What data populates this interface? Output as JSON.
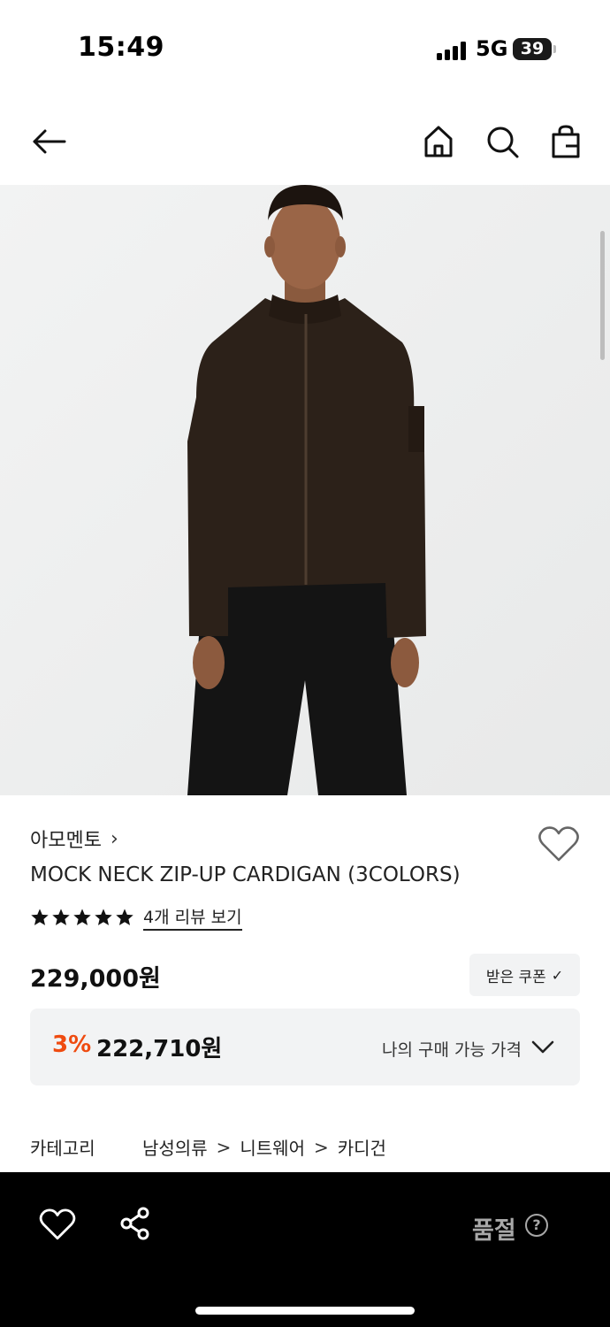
{
  "status_bar": {
    "time": "15:49",
    "network": "5G",
    "battery": "39"
  },
  "nav": {
    "back_icon": "arrow-left-icon",
    "home_icon": "home-icon",
    "search_icon": "search-icon",
    "cart_icon": "shopping-bag-icon"
  },
  "product": {
    "image_alt": "model wearing dark brown zip-up cardigan",
    "brand": "아모멘토",
    "brand_chevron": "›",
    "name": "MOCK NECK ZIP-UP CARDIGAN (3COLORS)",
    "rating": 5,
    "rating_max": 5,
    "review_link": "4개 리뷰 보기",
    "price": "229,000원",
    "coupon_label": "받은 쿠폰",
    "coupon_check": "✓",
    "discount_rate": "3%",
    "final_price": "222,710원",
    "my_price_label": "나의 구매 가능 가격"
  },
  "category": {
    "label": "카테고리",
    "path": [
      "남성의류",
      "니트웨어",
      "카디건"
    ],
    "separator": ">"
  },
  "bottom_bar": {
    "wishlist_icon": "heart-icon",
    "share_icon": "share-icon",
    "status": "품절",
    "help": "?"
  },
  "colors": {
    "discount": "#ef4b10",
    "bottom_bar_bg": "#000000",
    "soldout_text": "#a8a8a8",
    "panel_bg": "#f2f3f4"
  }
}
